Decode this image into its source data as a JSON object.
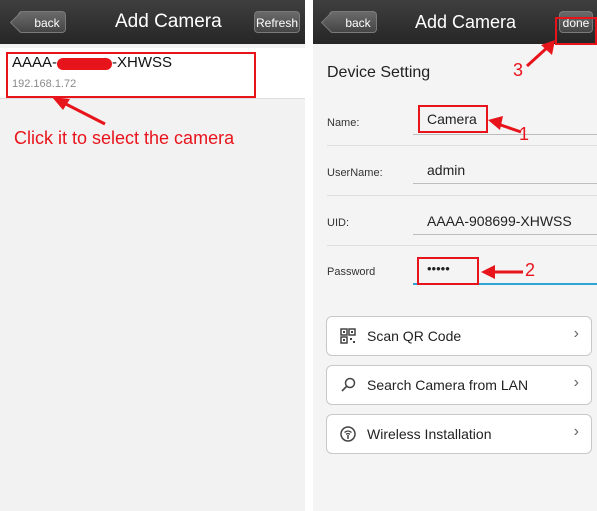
{
  "left": {
    "back_label": "back",
    "title": "Add Camera",
    "refresh_label": "Refresh",
    "camera": {
      "name_prefix": "AAAA-",
      "name_suffix": "-XHWSS",
      "ip": "192.168.1.72"
    },
    "annotation": "Click it to select the camera"
  },
  "right": {
    "back_label": "back",
    "title": "Add Camera",
    "done_label": "done",
    "section_title": "Device Setting",
    "fields": {
      "name": {
        "label": "Name:",
        "value": "Camera"
      },
      "username": {
        "label": "UserName:",
        "value": "admin"
      },
      "uid": {
        "label": "UID:",
        "value": "AAAA-908699-XHWSS"
      },
      "password": {
        "label": "Password",
        "value": "•••••"
      }
    },
    "buttons": {
      "scan_qr": "Scan QR Code",
      "search_lan": "Search Camera from LAN",
      "wireless": "Wireless Installation"
    },
    "annotations": {
      "one": "1",
      "two": "2",
      "three": "3"
    }
  },
  "colors": {
    "annotation_red": "#e8141c",
    "navbar": "#2e2e2e"
  },
  "icons": [
    "qr-code-icon",
    "search-icon",
    "wireless-icon",
    "chevron-right-icon"
  ]
}
